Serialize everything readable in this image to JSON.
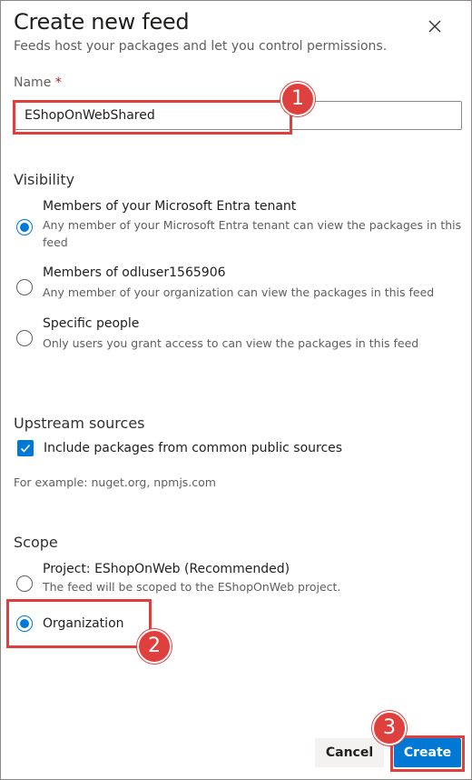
{
  "dialog": {
    "title": "Create new feed",
    "subtitle": "Feeds host your packages and let you control permissions."
  },
  "name": {
    "label": "Name",
    "required_mark": "*",
    "value": "EShopOnWebShared"
  },
  "visibility": {
    "heading": "Visibility",
    "options": [
      {
        "label": "Members of your Microsoft Entra tenant",
        "desc_line1": "Any member of your Microsoft Entra tenant can view the packages in this",
        "desc_line2": "feed",
        "checked": true
      },
      {
        "label": "Members of odluser1565906",
        "desc_line1": "Any member of your organization can view the packages in this feed",
        "checked": false
      },
      {
        "label": "Specific people",
        "desc_line1": "Only users you grant access to can view the packages in this feed",
        "checked": false
      }
    ]
  },
  "upstream": {
    "heading": "Upstream sources",
    "checkbox_label": "Include packages from common public sources",
    "checked": true,
    "example": "For example: nuget.org, npmjs.com"
  },
  "scope": {
    "heading": "Scope",
    "options": [
      {
        "label": "Project: EShopOnWeb (Recommended)",
        "desc": "The feed will be scoped to the EShopOnWeb project.",
        "checked": false
      },
      {
        "label": "Organization",
        "checked": true
      }
    ]
  },
  "footer": {
    "cancel_label": "Cancel",
    "create_label": "Create"
  },
  "annotations": {
    "step1": "1",
    "step2": "2",
    "step3": "3",
    "color": "#e0403d"
  },
  "colors": {
    "accent": "#0078d4",
    "required": "#a4262c"
  }
}
